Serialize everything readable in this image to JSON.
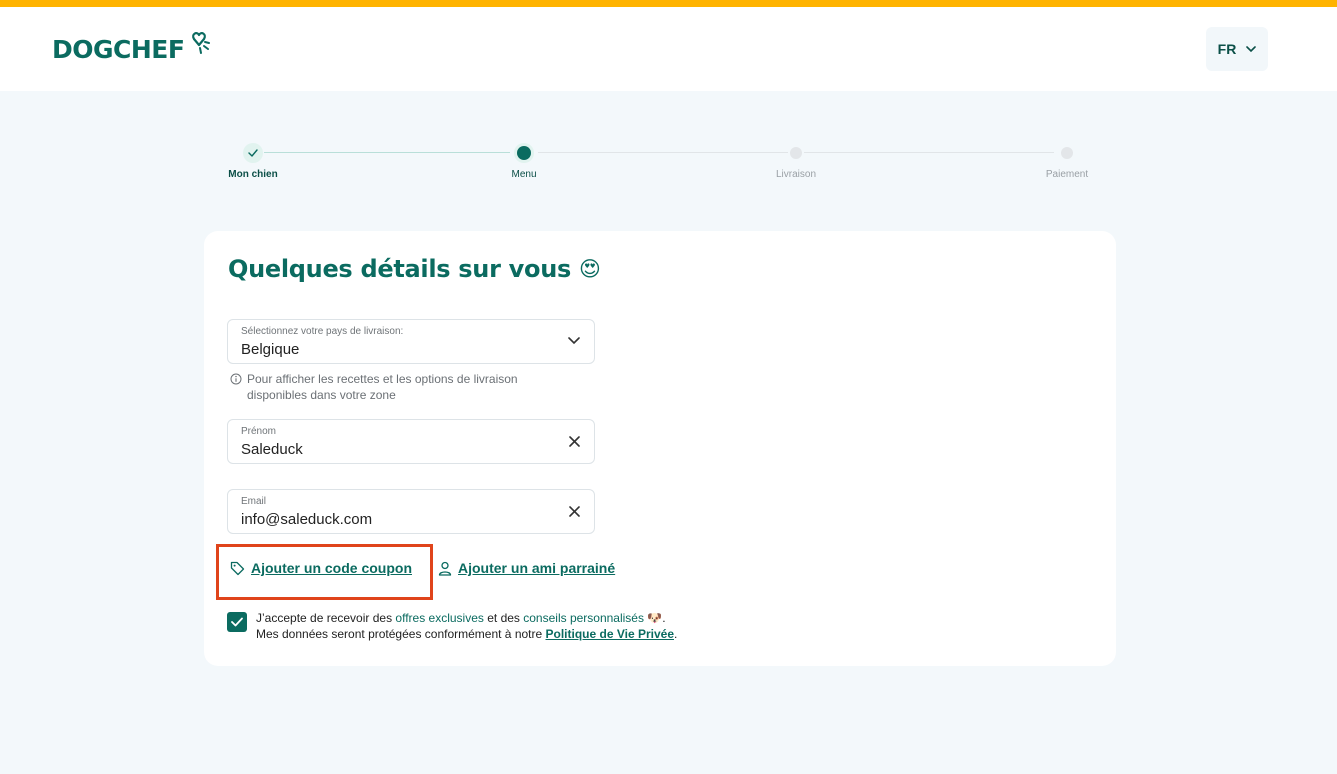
{
  "brand": {
    "logo_text": "DOGCHEF",
    "accent": "#0b6b60",
    "topbar": "#ffb300"
  },
  "header": {
    "language": "FR"
  },
  "stepper": {
    "steps": [
      {
        "label": "Mon chien",
        "state": "done"
      },
      {
        "label": "Menu",
        "state": "current"
      },
      {
        "label": "Livraison",
        "state": "todo"
      },
      {
        "label": "Paiement",
        "state": "todo"
      }
    ]
  },
  "form": {
    "title": "Quelques détails sur vous",
    "title_emoji": "😍",
    "country": {
      "label": "Sélectionnez votre pays de livraison:",
      "value": "Belgique"
    },
    "hint": "Pour afficher les recettes et les options de livraison disponibles dans votre zone",
    "first_name": {
      "label": "Prénom",
      "value": "Saleduck"
    },
    "email": {
      "label": "Email",
      "value": "info@saleduck.com"
    },
    "coupon_link": "Ajouter un code coupon",
    "referral_link": "Ajouter un ami parrainé",
    "consent": {
      "checked": true,
      "part1": "J’accepte de recevoir des ",
      "offers": "offres exclusives",
      "part2": " et des ",
      "advice": "conseils personnalisés",
      "emoji": "🐶",
      "part3": ".",
      "line2": "Mes données seront protégées conformément à notre ",
      "policy": "Politique de Vie Privée",
      "end": "."
    }
  }
}
